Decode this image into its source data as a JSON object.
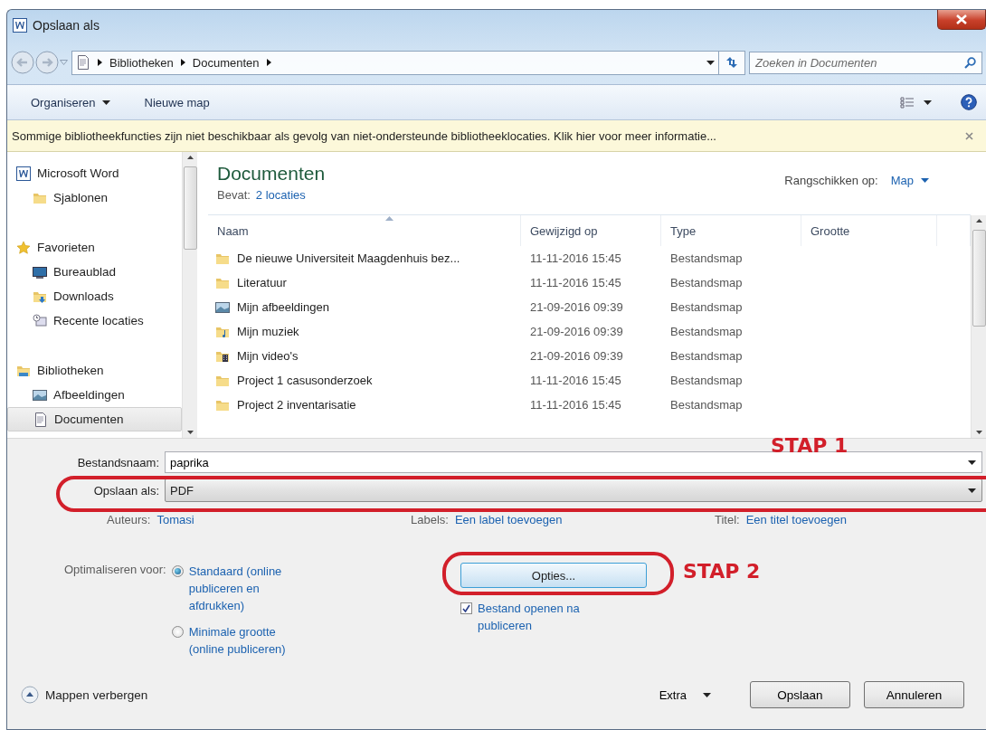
{
  "window": {
    "title": "Opslaan als"
  },
  "address_bar": {
    "crumbs": [
      "Bibliotheken",
      "Documenten"
    ]
  },
  "search": {
    "placeholder": "Zoeken in Documenten"
  },
  "toolbar": {
    "items": [
      {
        "label": "Organiseren",
        "kind": "menu"
      },
      {
        "label": "Nieuwe map",
        "kind": "button"
      }
    ]
  },
  "info_bar": {
    "text": "Sommige bibliotheekfuncties zijn niet beschikbaar als gevolg van niet-ondersteunde bibliotheeklocaties. Klik hier voor meer informatie..."
  },
  "sidebar": {
    "groups": [
      {
        "label": "Microsoft Word",
        "kind": "app",
        "selected": false,
        "children": [
          {
            "label": "Sjablonen",
            "kind": "folder",
            "selected": false
          }
        ]
      },
      {
        "label": "Favorieten",
        "kind": "star",
        "selected": false,
        "children": [
          {
            "label": "Bureaublad",
            "kind": "desktop",
            "selected": false
          },
          {
            "label": "Downloads",
            "kind": "download",
            "selected": false
          },
          {
            "label": "Recente locaties",
            "kind": "recent",
            "selected": false
          }
        ]
      },
      {
        "label": "Bibliotheken",
        "kind": "library",
        "selected": false,
        "children": [
          {
            "label": "Afbeeldingen",
            "kind": "pictures",
            "selected": false
          },
          {
            "label": "Documenten",
            "kind": "document",
            "selected": true
          }
        ]
      }
    ]
  },
  "library_header": {
    "title": "Documenten",
    "contains_label": "Bevat:",
    "contains_link": "2 locaties",
    "arrange_label": "Rangschikken op:",
    "arrange_value": "Map"
  },
  "table": {
    "columns": [
      "Naam",
      "Gewijzigd op",
      "Type",
      "Grootte"
    ],
    "rows": [
      {
        "name": "De nieuwe Universiteit Maagdenhuis bez...",
        "kind": "folder",
        "modified": "11-11-2016 15:45",
        "type": "Bestandsmap"
      },
      {
        "name": "Literatuur",
        "kind": "folder",
        "modified": "11-11-2016 15:45",
        "type": "Bestandsmap"
      },
      {
        "name": "Mijn afbeeldingen",
        "kind": "pictures",
        "modified": "21-09-2016 09:39",
        "type": "Bestandsmap"
      },
      {
        "name": "Mijn muziek",
        "kind": "music",
        "modified": "21-09-2016 09:39",
        "type": "Bestandsmap"
      },
      {
        "name": "Mijn video's",
        "kind": "video",
        "modified": "21-09-2016 09:39",
        "type": "Bestandsmap"
      },
      {
        "name": "Project 1 casusonderzoek",
        "kind": "folder",
        "modified": "11-11-2016 15:45",
        "type": "Bestandsmap"
      },
      {
        "name": "Project 2 inventarisatie",
        "kind": "folder",
        "modified": "11-11-2016 15:45",
        "type": "Bestandsmap"
      }
    ]
  },
  "form": {
    "filename_label": "Bestandsnaam:",
    "filename": "paprika",
    "save_as_label": "Opslaan als:",
    "save_as": "PDF"
  },
  "metadata": [
    {
      "label": "Auteurs:",
      "value": "Tomasi"
    },
    {
      "label": "Labels:",
      "value": "Een label toevoegen"
    },
    {
      "label": "Titel:",
      "value": "Een titel toevoegen"
    }
  ],
  "optimize": {
    "label": "Optimaliseren voor:",
    "options": [
      {
        "label": "Standaard (online publiceren en afdrukken)",
        "selected": true
      },
      {
        "label": "Minimale grootte (online publiceren)",
        "selected": false
      }
    ]
  },
  "options_button": "Opties...",
  "open_after": {
    "label": "Bestand openen na publiceren",
    "checked": true
  },
  "footer": {
    "toggle": "Mappen verbergen",
    "extra": "Extra",
    "buttons": [
      "Opslaan",
      "Annuleren"
    ]
  },
  "annotations": [
    "STAP 1",
    "STAP 2"
  ]
}
